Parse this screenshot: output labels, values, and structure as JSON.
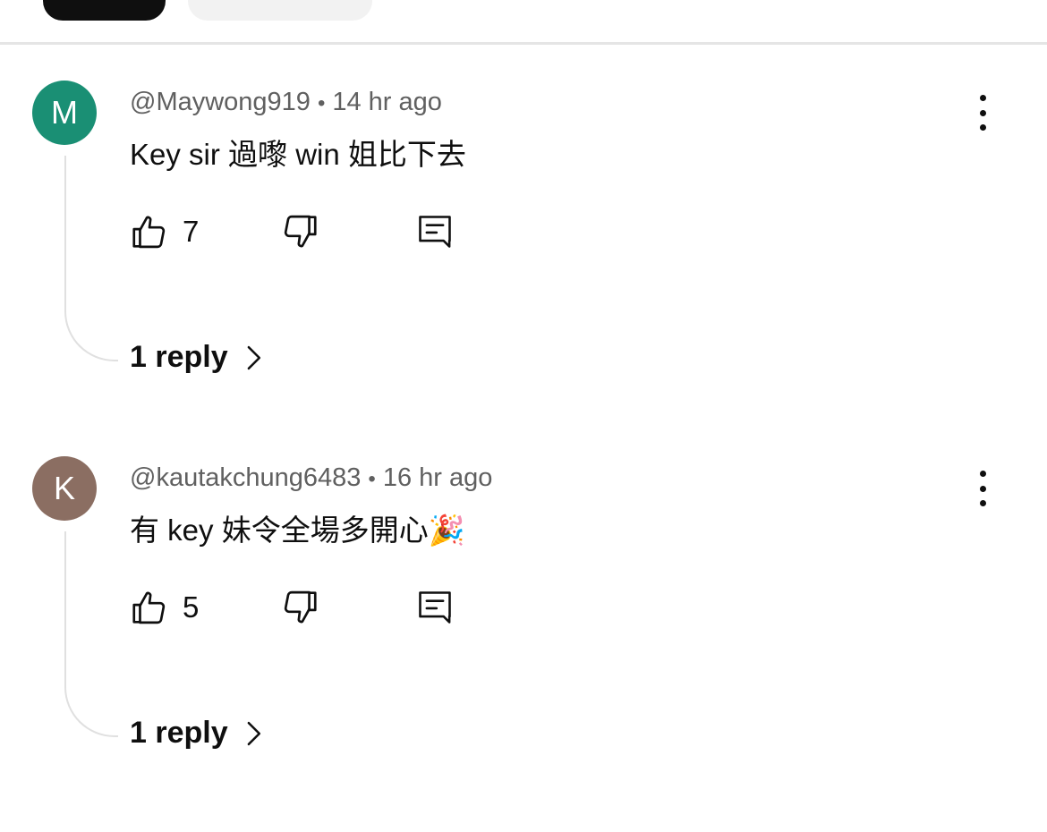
{
  "comments": [
    {
      "avatar_letter": "M",
      "avatar_color": "#1a8f74",
      "author": "@Maywong919",
      "separator": "•",
      "time": "14 hr ago",
      "text": "Key sir 過嚟 win 姐比下去",
      "likes": "7",
      "replies_label": "1 reply"
    },
    {
      "avatar_letter": "K",
      "avatar_color": "#8b6e62",
      "author": "@kautakchung6483",
      "separator": "•",
      "time": "16 hr ago",
      "text": "有 key 妹令全場多開心🎉",
      "likes": "5",
      "replies_label": "1 reply"
    }
  ],
  "icons": {
    "like": "thumbs-up-icon",
    "dislike": "thumbs-down-icon",
    "reply": "comment-reply-icon",
    "more": "more-vertical-icon",
    "expand": "chevron-right-icon"
  },
  "colors": {
    "text": "#0f0f0f",
    "secondary_text": "#606060",
    "thread_line": "#e0e0e0"
  }
}
